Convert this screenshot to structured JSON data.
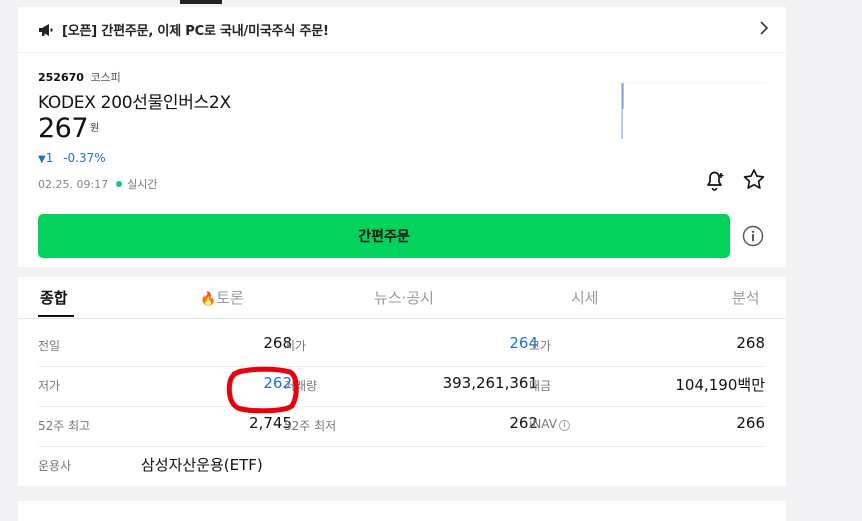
{
  "notice": {
    "text": "[오픈] 간편주문, 이제 PC로 국내/미국주식 주문!",
    "icon": "megaphone-icon"
  },
  "stock": {
    "code": "252670",
    "market": "코스피",
    "name": "KODEX 200선물인버스2X",
    "price": "267",
    "unit": "원",
    "change_arrow": "▼",
    "change": "1",
    "change_pct": "-0.37%",
    "time": "02.25. 09:17",
    "live_label": "실시간",
    "down_color": "#1e6fd9"
  },
  "order": {
    "button_label": "간편주문",
    "button_color": "#03d35c"
  },
  "tabs": [
    {
      "label": "종합",
      "active": true
    },
    {
      "label": "토론",
      "active": false
    },
    {
      "label": "뉴스·공시",
      "active": false
    },
    {
      "label": "시세",
      "active": false
    },
    {
      "label": "분석",
      "active": false
    }
  ],
  "table": {
    "row1": {
      "l1": "전일",
      "v1": "268",
      "l2": "시가",
      "v2": "264",
      "l3": "고가",
      "v3": "268"
    },
    "row2": {
      "l1": "저가",
      "v1": "262",
      "l2": "거래량",
      "v2": "393,261,361",
      "l3": "대금",
      "v3": "104,190백만"
    },
    "row3": {
      "l1": "52주 최고",
      "v1": "2,745",
      "l2": "52주 최저",
      "v2": "262",
      "l3": "iNAV",
      "v3": "266"
    },
    "row4": {
      "l1": "운용사",
      "v1": "삼성자산운용(ETF)"
    }
  },
  "annotation_color": "#e8000f"
}
